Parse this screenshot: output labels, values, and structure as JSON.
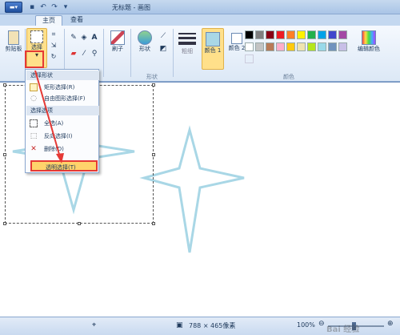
{
  "window": {
    "title": "无标题 - 画图"
  },
  "tabs": [
    {
      "label": "主页"
    },
    {
      "label": "查看"
    }
  ],
  "ribbon": {
    "clipboard_label": "剪贴板",
    "select_label": "选择",
    "brushes_label": "刷子",
    "shapes_label": "形状",
    "shapes_group_label": "形状",
    "size_label": "粗细",
    "color1_label": "颜色 1",
    "color2_label": "颜色 2",
    "edit_colors_label": "编辑颜色",
    "colors_group_label": "颜色"
  },
  "palette": [
    "#000000",
    "#7f7f7f",
    "#880015",
    "#ed1c24",
    "#ff7f27",
    "#fff200",
    "#22b14c",
    "#00a2e8",
    "#3f48cc",
    "#a349a4",
    "#ffffff",
    "#c3c3c3",
    "#b97a57",
    "#ffaec9",
    "#ffc90e",
    "#efe4b0",
    "#b5e61d",
    "#99d9ea",
    "#7092be",
    "#c8bfe7"
  ],
  "dropdown": {
    "section_shape": "选择形状",
    "rect_select": "矩形选择(R)",
    "free_select": "自由图形选择(F)",
    "section_options": "选择选项",
    "select_all": "全选(A)",
    "invert_select": "反向选择(I)",
    "delete": "删除(D)",
    "transparent_select": "透明选择(T)"
  },
  "status": {
    "dimensions": "788 × 465像素",
    "zoom": "100%"
  },
  "colors": {
    "star": "#a9d7e6",
    "highlight": "#e53935",
    "accent": "#ffd36b"
  },
  "watermark": "Bai 经验"
}
